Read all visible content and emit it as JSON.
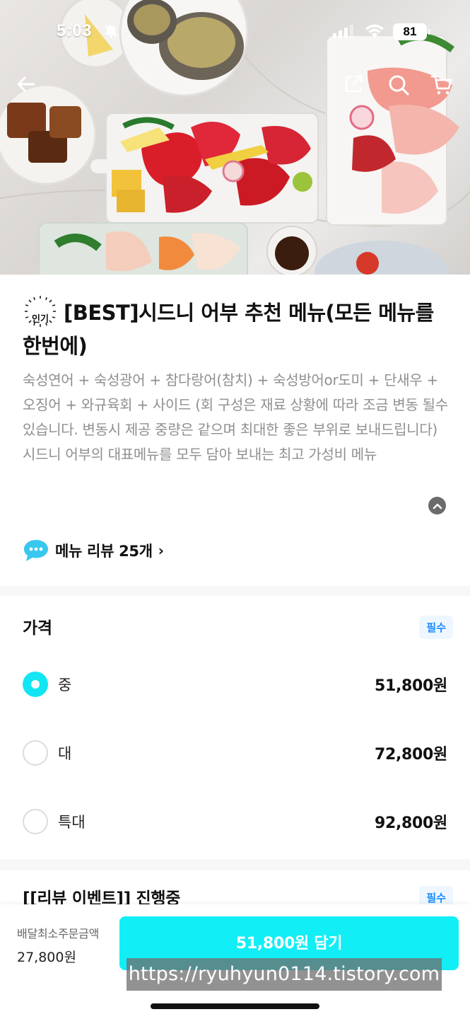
{
  "status_bar": {
    "time": "5:03",
    "battery": "81"
  },
  "menu": {
    "badge_text": "인기",
    "title": "[BEST]시드니 어부 추천 메뉴(모든 메뉴를 한번에)",
    "description_lines": [
      "숙성연어 + 숙성광어 + 참다랑어(참치) + 숙성방어or도미 + 단새우 + 오징어 + 와규육회 + 사이드 (회 구성은 재료 상황에 따라 조금 변동 될수 있습니다. 변동시 제공 중량은 같으며 최대한 좋은 부위로 보내드립니다)",
      "시드니 어부의 대표메뉴를 모두 담아 보내는 최고 가성비 메뉴"
    ],
    "review_link": "메뉴 리뷰 25개"
  },
  "price_section": {
    "title": "가격",
    "required": "필수",
    "options": [
      {
        "label": "중",
        "price": "51,800원",
        "selected": true
      },
      {
        "label": "대",
        "price": "72,800원",
        "selected": false
      },
      {
        "label": "특대",
        "price": "92,800원",
        "selected": false
      }
    ]
  },
  "event_section": {
    "title": "[[리뷰 이벤트]] 진행중",
    "required": "필수"
  },
  "bottom_bar": {
    "min_order_label": "배달최소주문금액",
    "min_order_value": "27,800원",
    "add_button": "51,800원 담기"
  },
  "watermark": "https://ryuhyun0114.tistory.com",
  "colors": {
    "accent": "#12EEF5",
    "radio_selected": "#12E6F2",
    "required_text": "#1A8CFF"
  }
}
